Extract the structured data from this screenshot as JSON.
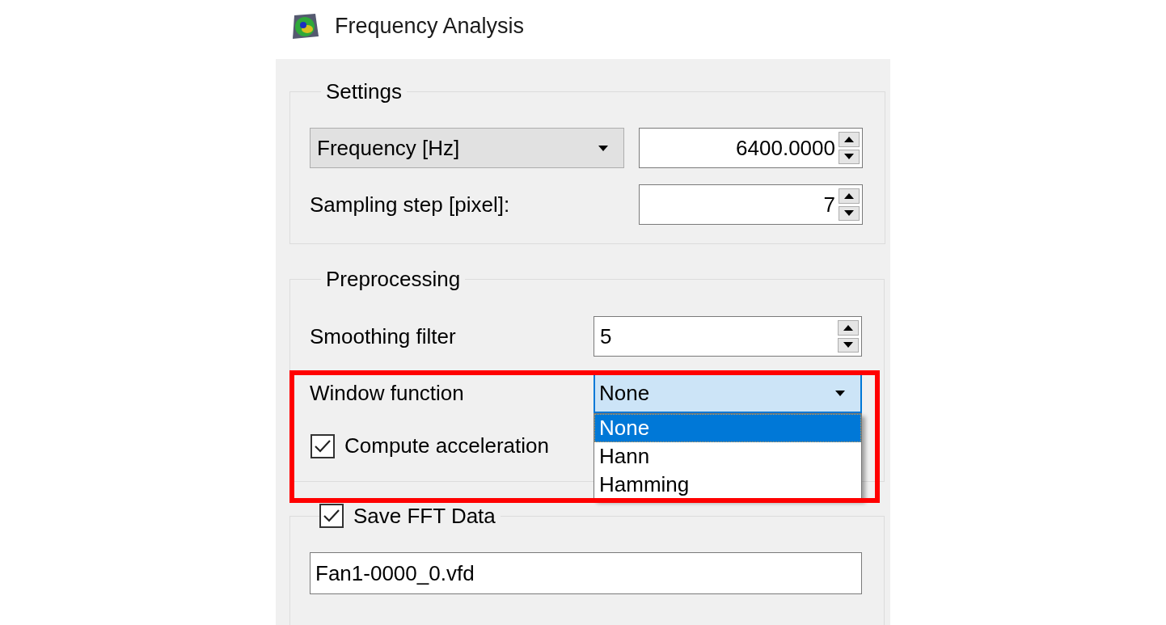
{
  "window": {
    "title": "Frequency Analysis"
  },
  "settings": {
    "title": "Settings",
    "quantity": {
      "value": "Frequency [Hz]"
    },
    "quantity_value": {
      "value": "6400.0000"
    },
    "sampling_step": {
      "label": "Sampling step [pixel]:",
      "value": "7"
    }
  },
  "preprocessing": {
    "title": "Preprocessing",
    "smoothing_filter": {
      "label": "Smoothing filter",
      "value": "5"
    },
    "window_function": {
      "label": "Window function",
      "value": "None",
      "expanded": true,
      "options": [
        {
          "label": "None",
          "selected": true
        },
        {
          "label": "Hann",
          "selected": false
        },
        {
          "label": "Hamming",
          "selected": false
        }
      ]
    },
    "compute_acceleration": {
      "label": "Compute acceleration",
      "checked": true
    }
  },
  "save_fft": {
    "label": "Save FFT Data",
    "checked": true,
    "filename": "Fan1-0000_0.vfd"
  },
  "highlight": {
    "visible": true
  }
}
